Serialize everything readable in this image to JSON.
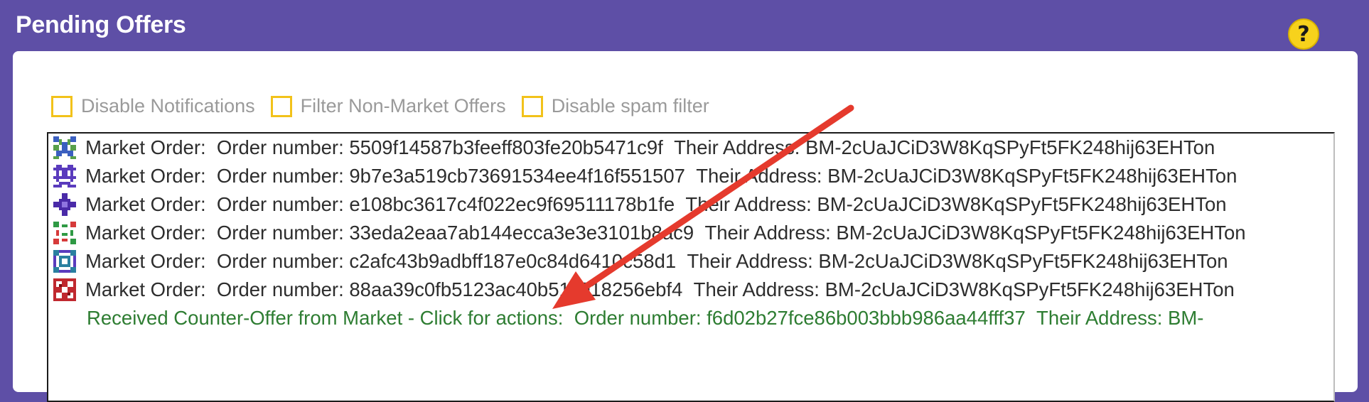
{
  "window": {
    "title": "Pending Offers",
    "help_label": "?"
  },
  "options": [
    {
      "label": "Disable Notifications",
      "checked": false
    },
    {
      "label": "Filter Non-Market Offers",
      "checked": false
    },
    {
      "label": "Disable spam filter",
      "checked": false
    }
  ],
  "offers": [
    {
      "type": "Market Order:",
      "order_label": "Order number:",
      "order": "5509f14587b3feeff803fe20b5471c9f",
      "address_label": "Their Address:",
      "address": "BM-2cUaJCiD3W8KqSPyFt5FK248hij63EHTon",
      "icon": "identicon-blue"
    },
    {
      "type": "Market Order:",
      "order_label": "Order number:",
      "order": "9b7e3a519cb73691534ee4f16f551507",
      "address_label": "Their Address:",
      "address": "BM-2cUaJCiD3W8KqSPyFt5FK248hij63EHTon",
      "icon": "identicon-purple"
    },
    {
      "type": "Market Order:",
      "order_label": "Order number:",
      "order": "e108bc3617c4f022ec9f69511178b1fe",
      "address_label": "Their Address:",
      "address": "BM-2cUaJCiD3W8KqSPyFt5FK248hij63EHTon",
      "icon": "identicon-violet"
    },
    {
      "type": "Market Order:",
      "order_label": "Order number:",
      "order": "33eda2eaa7ab144ecca3e3e3101b8ac9",
      "address_label": "Their Address:",
      "address": "BM-2cUaJCiD3W8KqSPyFt5FK248hij63EHTon",
      "icon": "identicon-green"
    },
    {
      "type": "Market Order:",
      "order_label": "Order number:",
      "order": "c2afc43b9adbff187e0c84d6410c58d1",
      "address_label": "Their Address:",
      "address": "BM-2cUaJCiD3W8KqSPyFt5FK248hij63EHTon",
      "icon": "identicon-teal"
    },
    {
      "type": "Market Order:",
      "order_label": "Order number:",
      "order": "88aa39c0fb5123ac40b511018256ebf4",
      "address_label": "Their Address:",
      "address": "BM-2cUaJCiD3W8KqSPyFt5FK248hij63EHTon",
      "icon": "identicon-red"
    }
  ],
  "counter_offer": {
    "text": "Received Counter-Offer from Market - Click for actions:",
    "order_label": "Order number:",
    "order": "f6d02b27fce86b003bbb986aa44fff37",
    "address_label": "Their Address:",
    "address": "BM-"
  },
  "colors": {
    "window_bg": "#5e4fa6",
    "checkbox_border": "#f2c21a",
    "counter_text": "#2e7d32",
    "arrow": "#e53a2d",
    "help_button": "#f7d21c"
  }
}
